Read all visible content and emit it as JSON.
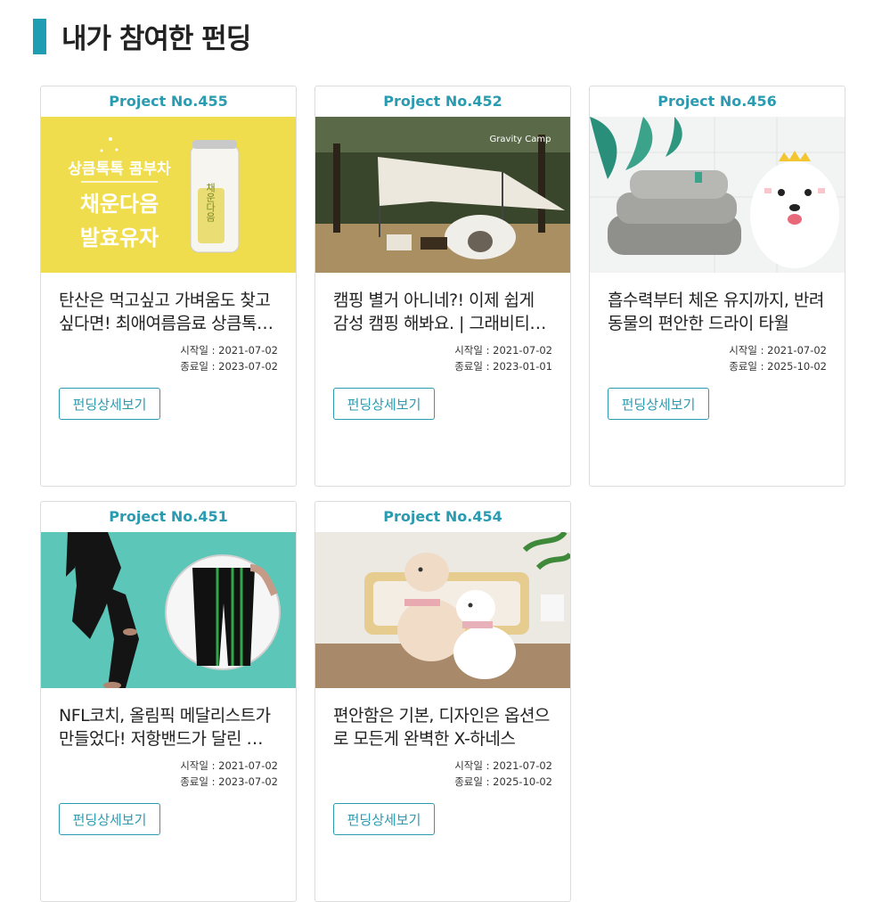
{
  "page": {
    "title": "내가 참여한 펀딩"
  },
  "labels": {
    "start_prefix": "시작일 : ",
    "end_prefix": "종료일 : "
  },
  "cards": [
    {
      "project_no": "Project No.455",
      "title": "탄산은 먹고싶고 가벼움도 찾고싶다면! 최애여름음료 상큼톡톡 콤부차",
      "start_date": "2021-07-02",
      "end_date": "2023-07-02",
      "button_label": "펀딩상세보기",
      "image": {
        "bg": "#f0dd4e",
        "texts": [
          "상큼톡톡 콤부차",
          "채운다음",
          "발효유자"
        ],
        "can_text": "채운다음"
      }
    },
    {
      "project_no": "Project No.452",
      "title": "캠핑 별거 아니네?! 이제 쉽게 감성 캠핑 해봐요. | 그래비티캠프",
      "start_date": "2021-07-02",
      "end_date": "2023-01-01",
      "button_label": "펀딩상세보기",
      "image": {
        "bg": "#3d4a2c",
        "brand": "Gravity Camp"
      }
    },
    {
      "project_no": "Project No.456",
      "title": "흡수력부터 체온 유지까지, 반려동물의 편안한 드라이 타월",
      "start_date": "2021-07-02",
      "end_date": "2025-10-02",
      "button_label": "펀딩상세보기",
      "image": {
        "bg": "#f2f4f3"
      }
    },
    {
      "project_no": "Project No.451",
      "title": "NFL코치, 올림픽 메달리스트가 만들었다! 저항밴드가 달린 트레이닝 팬츠",
      "start_date": "2021-07-02",
      "end_date": "2023-07-02",
      "button_label": "펀딩상세보기",
      "image": {
        "bg": "#5cc6b8"
      }
    },
    {
      "project_no": "Project No.454",
      "title": "편안함은 기본, 디자인은 옵션으로 모든게 완벽한 X-하네스",
      "start_date": "2021-07-02",
      "end_date": "2025-10-02",
      "button_label": "펀딩상세보기",
      "image": {
        "bg": "#e8e4de"
      }
    }
  ]
}
